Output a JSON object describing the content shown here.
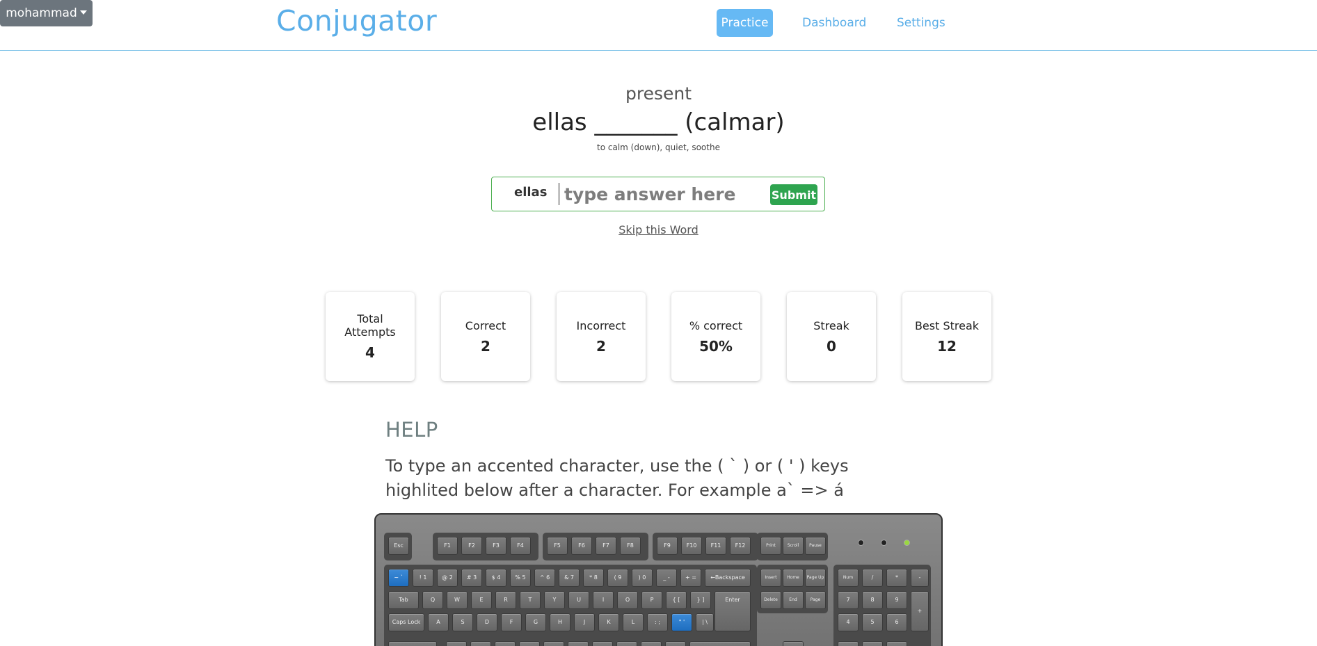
{
  "nav": {
    "brand": "Conjugator",
    "practice": "Practice",
    "dashboard": "Dashboard",
    "settings": "Settings",
    "user": "mohammad"
  },
  "question": {
    "tense": "present",
    "prompt": "ellas _______ (calmar)",
    "meaning": "to calm (down), quiet, soothe",
    "pronoun": "ellas",
    "placeholder": "type answer here",
    "submit": "Submit",
    "skip": "Skip this Word"
  },
  "stats": [
    {
      "label": "Total Attempts",
      "value": "4"
    },
    {
      "label": "Correct",
      "value": "2"
    },
    {
      "label": "Incorrect",
      "value": "2"
    },
    {
      "label": "% correct",
      "value": "50%"
    },
    {
      "label": "Streak",
      "value": "0"
    },
    {
      "label": "Best Streak",
      "value": "12"
    }
  ],
  "help": {
    "title": "HELP",
    "text": "To type an accented character, use the ( ` ) or ( ' ) keys highlited below after a character. For example a` => á"
  },
  "keyboard": {
    "row0": [
      "Esc",
      "F1",
      "F2",
      "F3",
      "F4",
      "F5",
      "F6",
      "F7",
      "F8",
      "F9",
      "F10",
      "F11",
      "F12",
      "Print",
      "Scroll",
      "Pause"
    ],
    "row1": [
      "~ `",
      "! 1",
      "@ 2",
      "# 3",
      "$ 4",
      "% 5",
      "^ 6",
      "& 7",
      "* 8",
      "( 9",
      ") 0",
      "_ -",
      "+ =",
      "←Backspace"
    ],
    "row2": [
      "Tab",
      "Q",
      "W",
      "E",
      "R",
      "T",
      "Y",
      "U",
      "I",
      "O",
      "P",
      "{ [",
      "} ]",
      "Enter"
    ],
    "row3": [
      "Caps Lock",
      "A",
      "S",
      "D",
      "F",
      "G",
      "H",
      "J",
      "K",
      "L",
      ": ;",
      "\" '",
      "| \\"
    ],
    "nav_keys": [
      "Insert",
      "Home",
      "Page Up",
      "Delete",
      "End",
      "Page Down"
    ],
    "num_keys": [
      "Num Lock",
      "/",
      "*",
      "-",
      "7",
      "8",
      "9",
      "+",
      "4",
      "5",
      "6"
    ],
    "highlight_color": "#1e6ec0"
  }
}
